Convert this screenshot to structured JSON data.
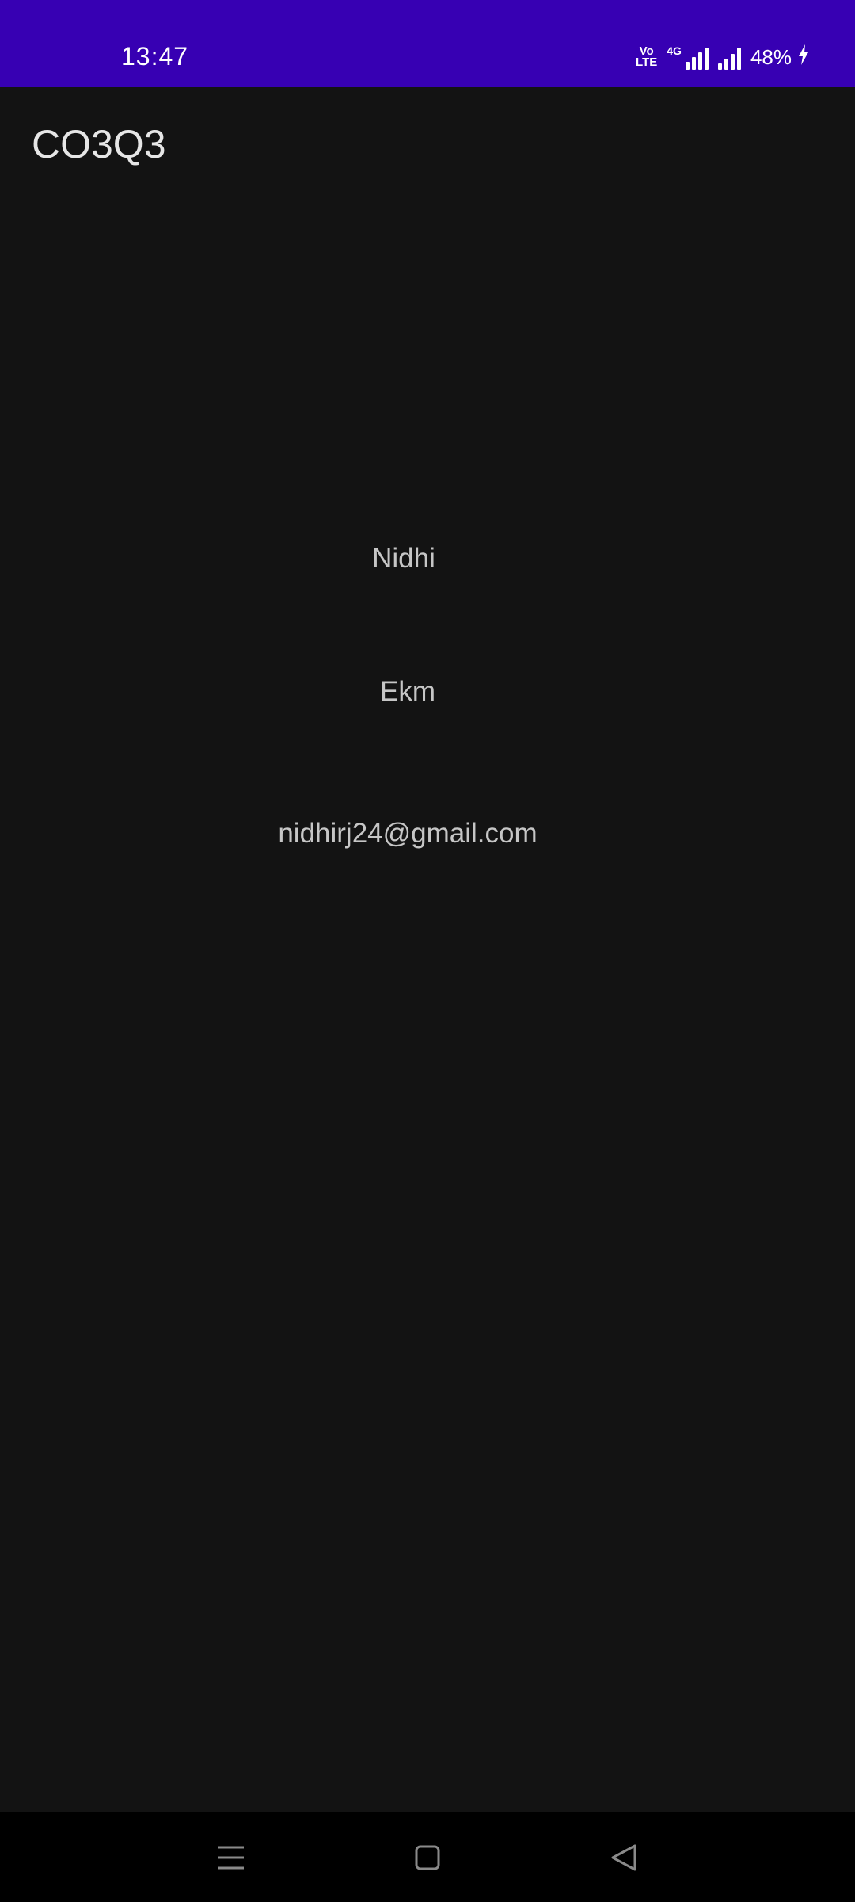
{
  "status_bar": {
    "time": "13:47",
    "volte_line1": "Vo",
    "volte_line2": "LTE",
    "network_type": "4G",
    "battery": "48%",
    "accent_color": "#3700b3"
  },
  "app_bar": {
    "title": "CO3Q3"
  },
  "content": {
    "name": "Nidhi",
    "place": "Ekm",
    "email": "nidhirj24@gmail.com"
  },
  "nav_bar": {
    "menu_icon": "menu-icon",
    "home_icon": "home-icon",
    "back_icon": "back-icon"
  }
}
